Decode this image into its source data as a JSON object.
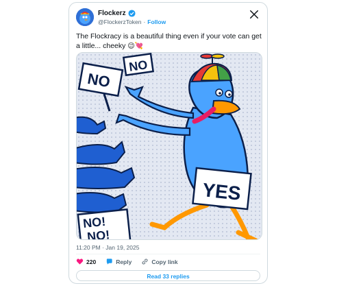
{
  "account": {
    "display_name": "Flockerz",
    "handle": "@FlockerzToken",
    "separator": "·",
    "follow_label": "Follow"
  },
  "tweet": {
    "text": "The Flockracy is a beautiful thing even if your vote can get a little... cheeky",
    "emojis": "😉💘",
    "timestamp": "11:20 PM · Jan 19, 2025"
  },
  "media": {
    "signs": [
      "NO",
      "NO",
      "YES",
      "NO!",
      "NO!"
    ]
  },
  "actions": {
    "like_count": "220",
    "reply_label": "Reply",
    "copy_link_label": "Copy link"
  },
  "read_replies_label": "Read 33 replies",
  "colors": {
    "accent": "#1d9bf0",
    "like": "#f91880",
    "bird": "#4aa3ff"
  }
}
